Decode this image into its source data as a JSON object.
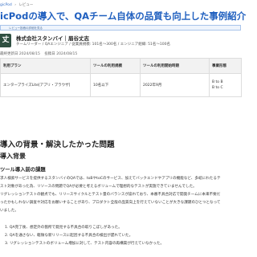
{
  "breadcrumb": {
    "items": [
      "gicPod",
      "›",
      "レビュー"
    ]
  },
  "page_title": "icPodの導入で、QAチーム自体の品質も向上した事例紹介",
  "notice_text": "レビュー投稿の詳細を見る",
  "reviewer": {
    "avatar_text": "丈志",
    "company": "株式会社スタンバイ｜眉谷丈志",
    "role": "チームリーダー / QAエンジニア / 従業員規模: 101名〜300名 / エンジニア組織: 51名〜100名"
  },
  "dates": {
    "updated": "最終更新日 2024/08/15",
    "posted": "投稿日 2024/08/15"
  },
  "usage_table": {
    "headers": [
      "利用プラン",
      "ツールの利用規模",
      "ツールの利用開始時期",
      "事業形態"
    ],
    "rows": [
      [
        "エンタープライズLite[アプリ・ブラウザ]",
        "10名以下",
        "2022年9月",
        "B to B / B to C"
      ]
    ]
  },
  "section": {
    "h2": "導入の背景・解決したかった問題",
    "h3": "導入背景",
    "h4": "ツール導入前の課題",
    "paragraph": [
      "求人検索サービスを提供するスタンバイのQAでは、toBやtoCのサービス、加えてバックエンドやアプリの機能など、多岐にわたるテ",
      "スト対象があった為、リソースの問題でQAが必要と考えるボリュームで理想的なテストが実施できていませんでした。",
      "リグレッションテストの観点でも、リリースサイクルとテスト量のバランスが崩れており、本番不具合対応で開発チームに本来不要だ",
      "ったかもしれない調査や対応をお願いすることがあり、プロダクト全般の品質向上を行えていないことが大きな課題のひとつとなって",
      "いました。"
    ],
    "list": [
      "1. QA完了後、想定外の箇所で発見する不具合の取りこぼしがあった。",
      "2. QAを通さない、軽微な新リリースに起因する不具合の検出が遅れていた。",
      "3. リグレッションテストのボリューム増加に対して、テスト内容の再構築が行えていなかった。"
    ]
  }
}
